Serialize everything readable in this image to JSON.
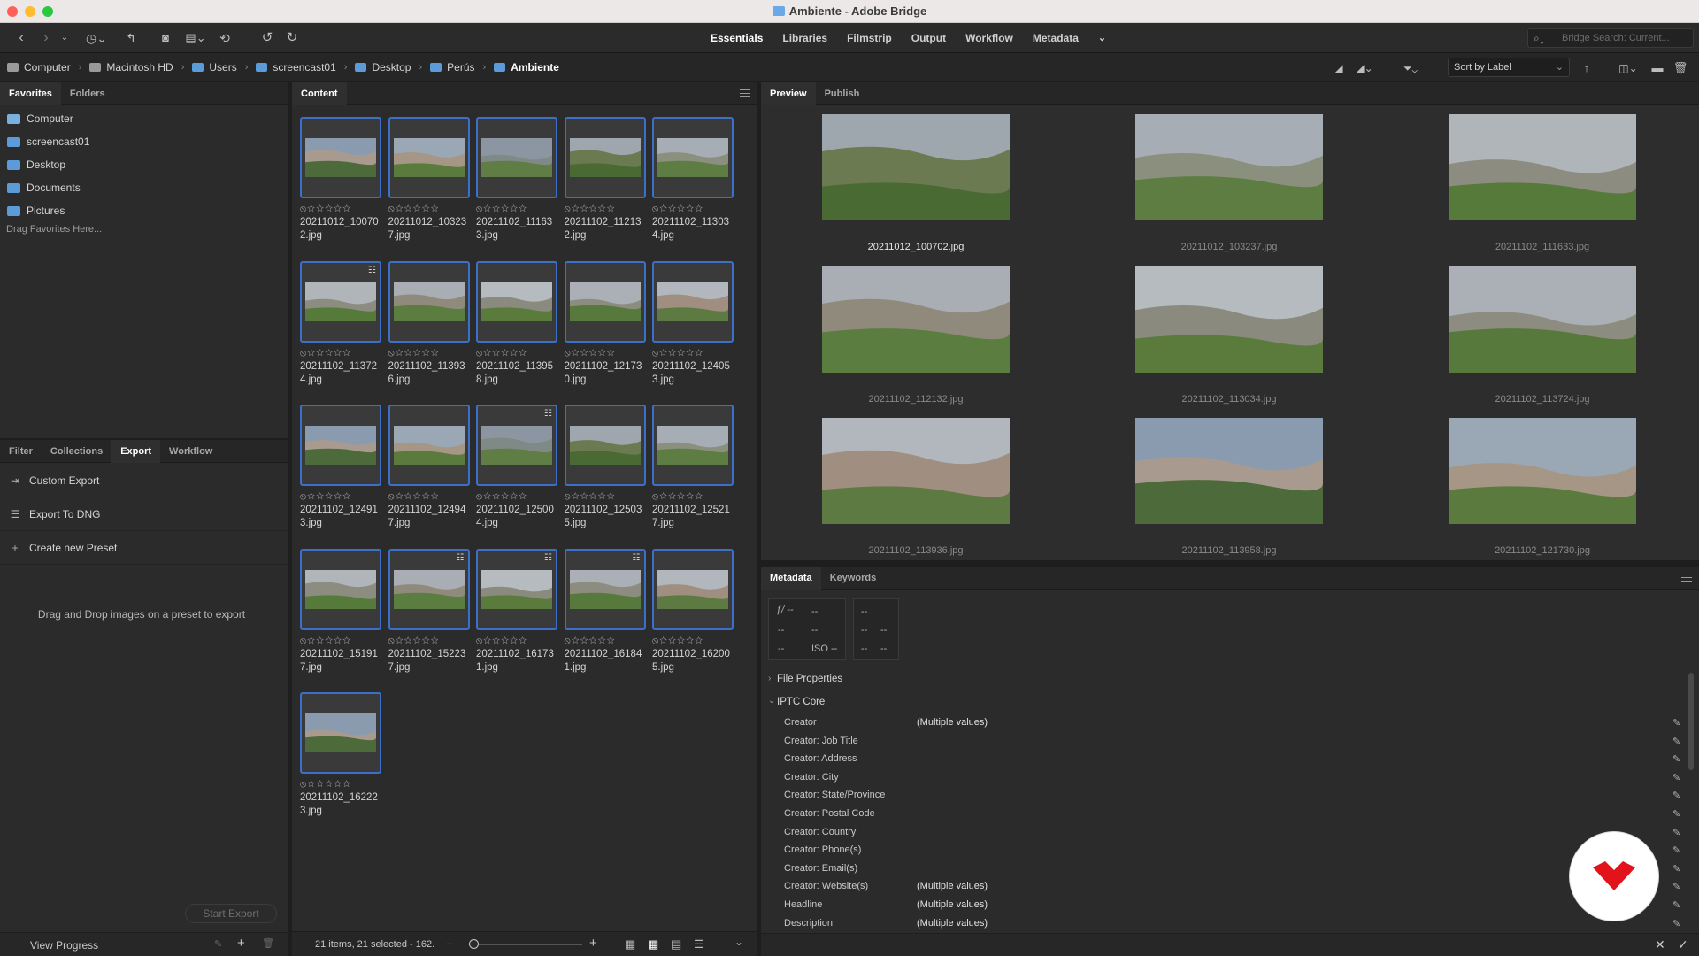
{
  "window": {
    "title": "Ambiente - Adobe Bridge"
  },
  "workspaces": [
    "Essentials",
    "Libraries",
    "Filmstrip",
    "Output",
    "Workflow",
    "Metadata"
  ],
  "active_workspace": "Essentials",
  "search": {
    "placeholder": "Bridge Search: Current..."
  },
  "breadcrumb": [
    "Computer",
    "Macintosh HD",
    "Users",
    "screencast01",
    "Desktop",
    "Perús",
    "Ambiente"
  ],
  "sort": {
    "label": "Sort by Label"
  },
  "left_top": {
    "tabs": [
      "Favorites",
      "Folders"
    ],
    "favorites": [
      "Computer",
      "screencast01",
      "Desktop",
      "Documents",
      "Pictures"
    ],
    "drag_hint": "Drag Favorites Here..."
  },
  "left_bottom": {
    "tabs": [
      "Filter",
      "Collections",
      "Export",
      "Workflow"
    ],
    "export_items": [
      "Custom Export",
      "Export To DNG",
      "Create new Preset"
    ],
    "drop_hint": "Drag and Drop images on a preset to export",
    "start_export": "Start Export",
    "view_progress": "View Progress"
  },
  "content": {
    "tab": "Content",
    "status": "21 items, 21 selected - 162.",
    "files": [
      "20211012_100702.jpg",
      "20211012_103237.jpg",
      "20211102_111633.jpg",
      "20211102_112132.jpg",
      "20211102_113034.jpg",
      "20211102_113724.jpg",
      "20211102_113936.jpg",
      "20211102_113958.jpg",
      "20211102_121730.jpg",
      "20211102_124053.jpg",
      "20211102_124913.jpg",
      "20211102_124947.jpg",
      "20211102_125004.jpg",
      "20211102_125035.jpg",
      "20211102_125217.jpg",
      "20211102_151917.jpg",
      "20211102_152237.jpg",
      "20211102_161731.jpg",
      "20211102_161841.jpg",
      "20211102_162005.jpg",
      "20211102_162223.jpg"
    ],
    "rating_glyph": "⦸☆☆☆☆☆"
  },
  "preview": {
    "tabs": [
      "Preview",
      "Publish"
    ],
    "images": [
      "20211012_100702.jpg",
      "20211012_103237.jpg",
      "20211102_111633.jpg",
      "20211102_112132.jpg",
      "20211102_113034.jpg",
      "20211102_113724.jpg",
      "20211102_113936.jpg",
      "20211102_113958.jpg",
      "20211102_121730.jpg"
    ]
  },
  "metadata": {
    "tabs": [
      "Metadata",
      "Keywords"
    ],
    "exif": {
      "fstop": "ƒ/ --",
      "v1": "--",
      "v2": "--",
      "v3": "--",
      "v4": "--",
      "iso": "ISO --",
      "r1": "--",
      "r2": "--",
      "r3": "--",
      "r4": "--",
      "r5": "--"
    },
    "sections": [
      "File Properties",
      "IPTC Core"
    ],
    "fields": [
      {
        "label": "Creator",
        "value": "(Multiple values)"
      },
      {
        "label": "Creator: Job Title",
        "value": ""
      },
      {
        "label": "Creator: Address",
        "value": ""
      },
      {
        "label": "Creator: City",
        "value": ""
      },
      {
        "label": "Creator: State/Province",
        "value": ""
      },
      {
        "label": "Creator: Postal Code",
        "value": ""
      },
      {
        "label": "Creator: Country",
        "value": ""
      },
      {
        "label": "Creator: Phone(s)",
        "value": ""
      },
      {
        "label": "Creator: Email(s)",
        "value": ""
      },
      {
        "label": "Creator: Website(s)",
        "value": "(Multiple values)"
      },
      {
        "label": "Headline",
        "value": "(Multiple values)"
      },
      {
        "label": "Description",
        "value": "(Multiple values)"
      }
    ]
  },
  "colors": {
    "accent": "#3c6fc7",
    "folder": "#5a9bd8",
    "brand": "#e3131b"
  }
}
